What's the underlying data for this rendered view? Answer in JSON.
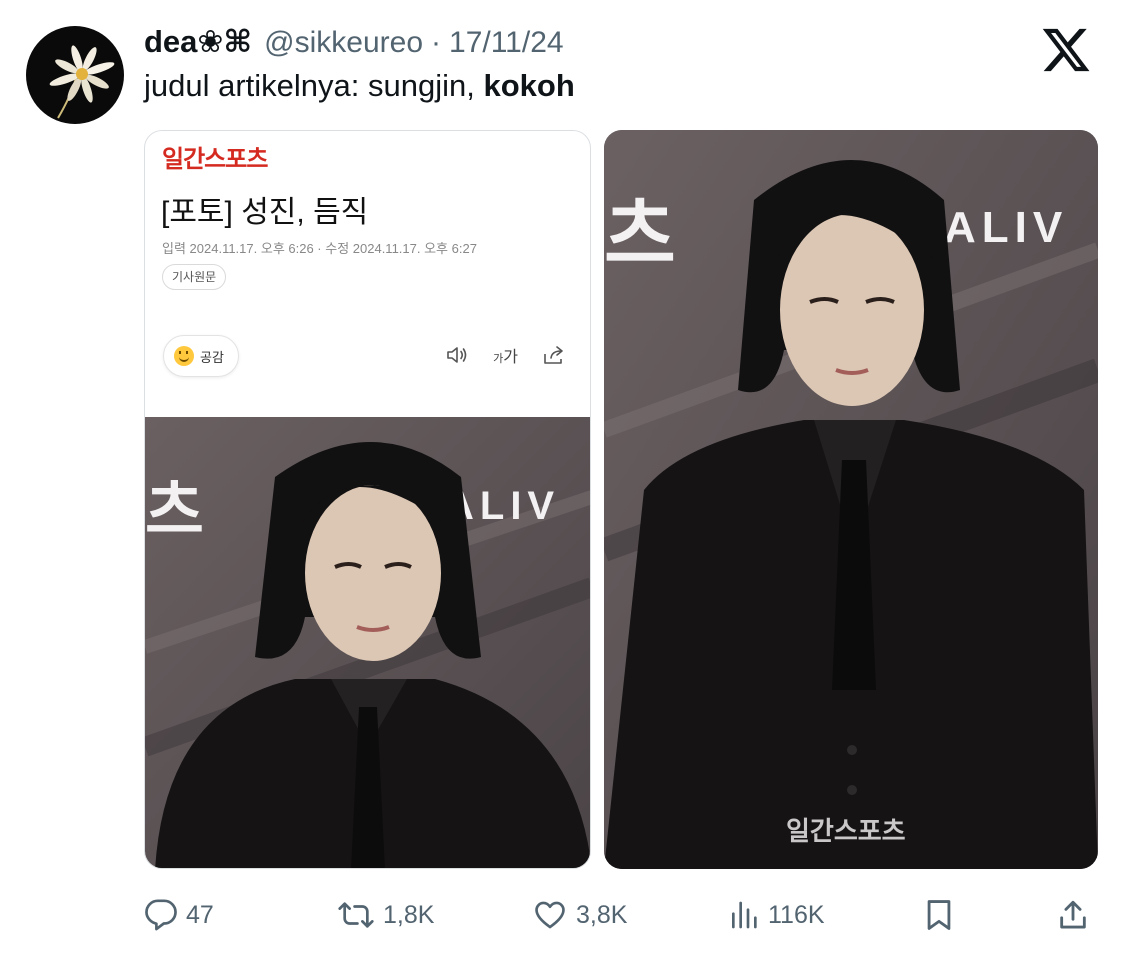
{
  "tweet": {
    "display_name": "dea❀⌘",
    "handle": "@sikkeureo",
    "separator": "·",
    "date": "17/11/24",
    "text_plain": "judul artikelnya: sungjin, ",
    "text_bold": "kokoh"
  },
  "article": {
    "brand": "일간스포츠",
    "title": "[포토] 성진, 듬직",
    "meta": "입력 2024.11.17. 오후 6:26 · 수정 2024.11.17. 오후 6:27",
    "source_chip": "기사원문",
    "like_label": "공감",
    "font_label_small": "가",
    "font_label_large": "가",
    "photo_sign_left": "츠",
    "photo_sign_right": "ALIV"
  },
  "photo_right": {
    "sign_left": "츠",
    "sign_right": "ALIV",
    "watermark": "일간스포츠"
  },
  "actions": {
    "replies": "47",
    "reposts": "1,8K",
    "likes": "3,8K",
    "views": "116K"
  },
  "icons": {
    "brand_logo": "x-logo-icon",
    "reply": "reply-icon",
    "repost": "repost-icon",
    "like": "heart-icon",
    "views": "views-chart-icon",
    "bookmark": "bookmark-icon",
    "share": "share-icon"
  },
  "colors": {
    "text": "#0f1419",
    "secondary": "#536471",
    "brand_red": "#d42a20",
    "backdrop": "#5d5456"
  }
}
